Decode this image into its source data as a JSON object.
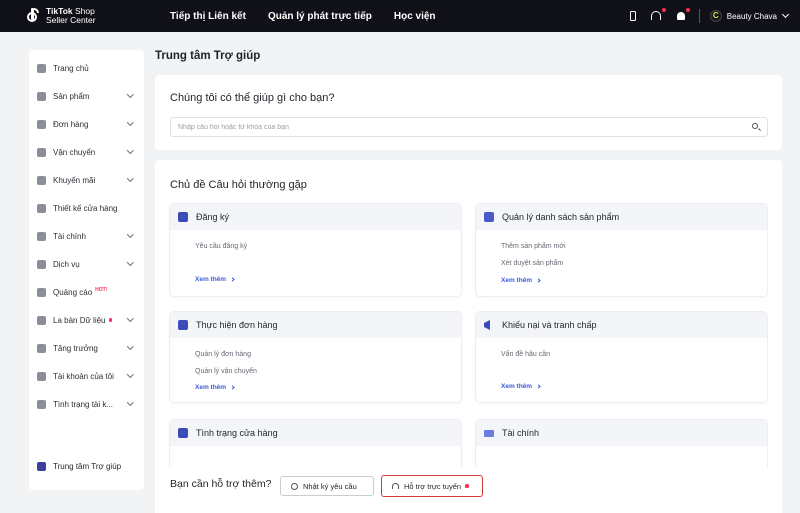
{
  "topbar": {
    "logo_line1": "TikTok Shop",
    "logo_line1_bold": "TikTok",
    "logo_line1_rest": " Shop",
    "logo_line2": "Seller Center",
    "nav": [
      "Tiếp thị Liên kết",
      "Quản lý phát trực tiếp",
      "Học viện"
    ],
    "icons": [
      "phone-icon",
      "headset-icon",
      "bell-icon"
    ],
    "avatar_letter": "C",
    "username": "Beauty Chava"
  },
  "sidebar": {
    "items": [
      {
        "label": "Trang chủ",
        "icon": "home-icon",
        "chevron": false
      },
      {
        "label": "Sản phẩm",
        "icon": "product-icon",
        "chevron": true
      },
      {
        "label": "Đơn hàng",
        "icon": "order-icon",
        "chevron": true
      },
      {
        "label": "Vận chuyển",
        "icon": "truck-icon",
        "chevron": true
      },
      {
        "label": "Khuyến mãi",
        "icon": "megaphone-icon",
        "chevron": true
      },
      {
        "label": "Thiết kế cửa hàng",
        "icon": "store-design-icon",
        "chevron": false
      },
      {
        "label": "Tài chính",
        "icon": "finance-icon",
        "chevron": true
      },
      {
        "label": "Dịch vụ",
        "icon": "service-icon",
        "chevron": true
      },
      {
        "label": "Quảng cáo",
        "icon": "ads-icon",
        "chevron": false,
        "badge": "HOT!"
      },
      {
        "label": "La bàn Dữ liệu",
        "icon": "compass-icon",
        "chevron": true,
        "dot": true
      },
      {
        "label": "Tăng trưởng",
        "icon": "growth-icon",
        "chevron": true
      },
      {
        "label": "Tài khoản của tôi",
        "icon": "account-icon",
        "chevron": true
      },
      {
        "label": "Tình trạng tài k...",
        "icon": "status-icon",
        "chevron": true
      }
    ],
    "help_center": "Trung tâm Trợ giúp"
  },
  "main": {
    "title": "Trung tâm Trợ giúp",
    "search": {
      "heading": "Chúng tôi có thể giúp gì cho bạn?",
      "placeholder": "Nhập câu hỏi hoặc từ khóa của bạn"
    },
    "faq": {
      "heading": "Chủ đề Câu hỏi thường gặp",
      "see_more": "Xem thêm",
      "topics": [
        {
          "title": "Đăng ký",
          "lines": [
            "Yêu cầu đăng ký"
          ]
        },
        {
          "title": "Quản lý danh sách sản phẩm",
          "lines": [
            "Thêm sản phẩm mới",
            "Xét duyệt sản phẩm"
          ]
        },
        {
          "title": "Thực hiện đơn hàng",
          "lines": [
            "Quản lý đơn hàng",
            "Quản lý vận chuyển"
          ]
        },
        {
          "title": "Khiếu nại và tranh chấp",
          "lines": [
            "Vấn đề hậu cần"
          ]
        },
        {
          "title": "Tình trạng cửa hàng",
          "lines": []
        },
        {
          "title": "Tài chính",
          "lines": []
        }
      ]
    },
    "help_bar": {
      "text": "Bạn cần hỗ trợ thêm?",
      "log_button": "Nhật ký yêu cầu",
      "live_button": "Hỗ trợ trực tuyến"
    }
  }
}
